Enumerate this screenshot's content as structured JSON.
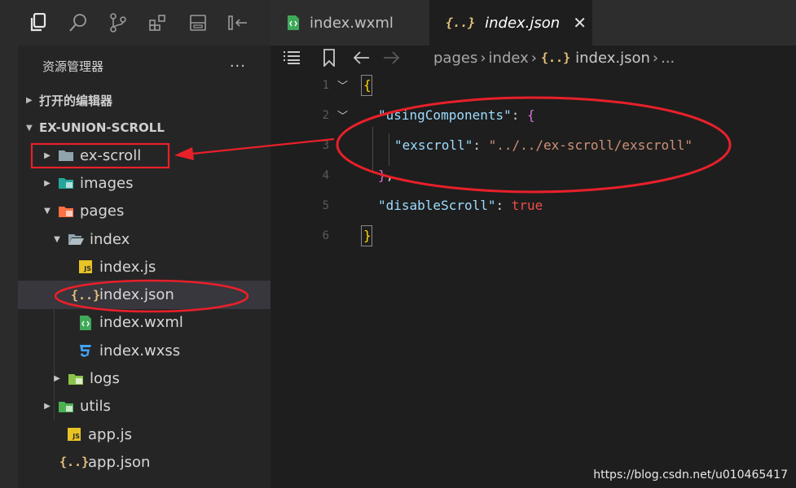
{
  "tabs": [
    {
      "label": "index.wxml",
      "active": false
    },
    {
      "label": "index.json",
      "active": true
    }
  ],
  "sidebar": {
    "title": "资源管理器",
    "more": "···",
    "sections": {
      "open_editors": "打开的编辑器",
      "project": "EX-UNION-SCROLL"
    },
    "tree": [
      {
        "label": "ex-scroll",
        "icon": "folder-icon"
      },
      {
        "label": "images",
        "icon": "images-folder-icon"
      },
      {
        "label": "pages",
        "icon": "pages-folder-icon"
      },
      {
        "label": "index",
        "icon": "open-folder-icon"
      },
      {
        "label": "index.js",
        "icon": "js-file-icon"
      },
      {
        "label": "index.json",
        "icon": "json-file-icon",
        "selected": true
      },
      {
        "label": "index.wxml",
        "icon": "wxml-file-icon"
      },
      {
        "label": "index.wxss",
        "icon": "css-file-icon"
      },
      {
        "label": "logs",
        "icon": "folder-icon"
      },
      {
        "label": "utils",
        "icon": "folder-icon"
      },
      {
        "label": "app.js",
        "icon": "js-file-icon"
      },
      {
        "label": "app.json",
        "icon": "json-file-icon"
      }
    ]
  },
  "breadcrumb": [
    "pages",
    "index",
    "index.json",
    "..."
  ],
  "json_icon_glyph": "{..}",
  "js_badge": "JS",
  "editor": {
    "line_numbers": [
      "1",
      "2",
      "3",
      "4",
      "5",
      "6"
    ],
    "lines": {
      "l1_open": "{",
      "l2_key": "\"usingComponents\"",
      "l2_colon": ": ",
      "l2_brace": "{",
      "l3_key": "\"exscroll\"",
      "l3_colon": ": ",
      "l3_value": "\"../../ex-scroll/exscroll\"",
      "l4_close": "}",
      "l4_comma": ",",
      "l5_key": "\"disableScroll\"",
      "l5_colon": ": ",
      "l5_value": "true",
      "l6_close": "}"
    }
  },
  "watermark": "https://blog.csdn.net/u010465417",
  "colors": {
    "annotation_red": "#e8202a",
    "json_key": "#9cdcfe",
    "json_string": "#ce9178",
    "json_bool": "#f14c4c",
    "brace_gold": "#ffd700",
    "brace_purple": "#da70d6"
  }
}
